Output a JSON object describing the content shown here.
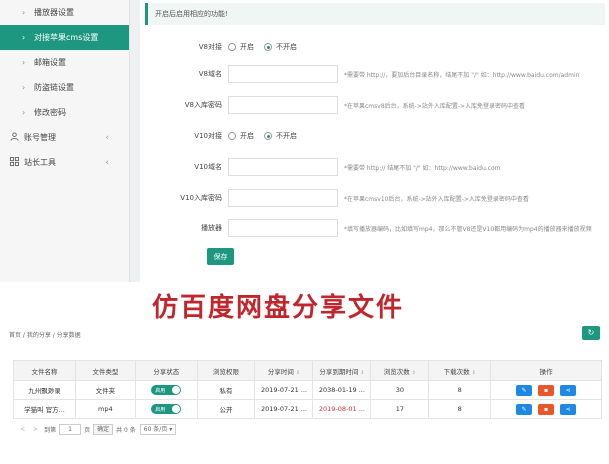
{
  "sidebar": {
    "items": [
      {
        "label": "播放器设置",
        "type": "sub",
        "active": false
      },
      {
        "label": "对接苹果cms设置",
        "type": "sub",
        "active": true
      },
      {
        "label": "邮箱设置",
        "type": "sub",
        "active": false
      },
      {
        "label": "防盗链设置",
        "type": "sub",
        "active": false
      },
      {
        "label": "修改密码",
        "type": "sub",
        "active": false
      },
      {
        "label": "账号管理",
        "type": "top",
        "icon": "user-icon"
      },
      {
        "label": "站长工具",
        "type": "top",
        "icon": "grid-icon"
      }
    ]
  },
  "form": {
    "banner": "开启后启用相应的功能!",
    "v8_switch_label": "V8对接",
    "v8_domain_label": "V8域名",
    "v8_domain_hint": "*需要带 http://，要加后台目录名称，结尾不加 \"/\" 如：http://www.baidu.com/admin",
    "v8_key_label": "V8入库密码",
    "v8_key_hint": "*在苹果cmsv8后台，系统->站外入库配置->入库免登录密码中查看",
    "v10_switch_label": "V10对接",
    "v10_domain_label": "V10域名",
    "v10_domain_hint": "*需要带 http:// 结尾不加 \"/\" 如：http://www.baidu.com",
    "v10_key_label": "V10入库密码",
    "v10_key_hint": "*在苹果cmsv10后台，系统->站外入库配置->入库免登录密码中查看",
    "player_label": "播放器",
    "player_hint": "*填写播放器编码，比如填写mp4，那么不管V8还是V10都用编码为mp4的播放器来播放视频",
    "radio_on": "开启",
    "radio_off": "不开启",
    "save_label": "保存"
  },
  "watermark": "仿百度网盘分享文件",
  "breadcrumb": "首页  /  我的分享  /  分享数据",
  "refresh_icon": "↻",
  "table": {
    "headers": [
      "文件名称",
      "文件类型",
      "分享状态",
      "浏览权限",
      "分享时间",
      "分享到期时间",
      "浏览次数",
      "下载次数",
      "操作"
    ],
    "toggle_label": "启用",
    "rows": [
      {
        "name": "九州飘渺录",
        "type": "文件夹",
        "perm": "私有",
        "share_time": "2019-07-21 ...",
        "expire": "2038-01-19 ...",
        "views": "30",
        "downloads": "8",
        "expire_red": false
      },
      {
        "name": "学猫叫 官方...",
        "type": "mp4",
        "perm": "公开",
        "share_time": "2019-07-21 ...",
        "expire": "2019-08-01 ...",
        "views": "17",
        "downloads": "8",
        "expire_red": true
      }
    ]
  },
  "pager": {
    "prev": "<",
    "next": ">",
    "to_label": "到第",
    "page_value": "1",
    "page_unit": "页",
    "confirm": "确定",
    "total": "共 0 条",
    "per_page": "60 条/页"
  }
}
